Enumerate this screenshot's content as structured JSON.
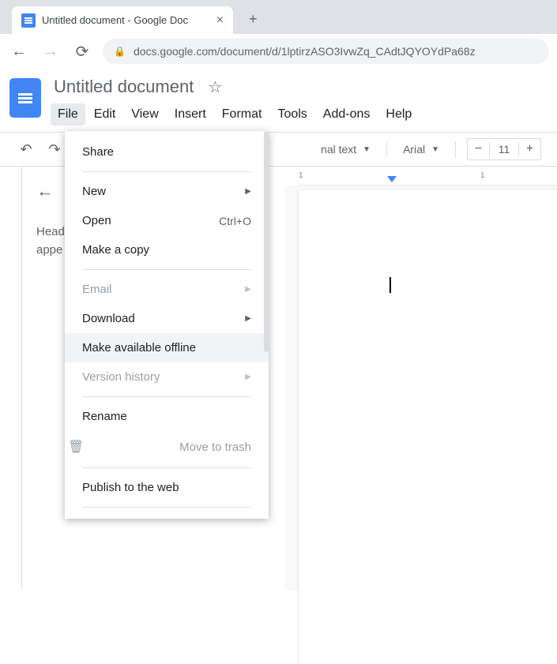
{
  "browser": {
    "tab_title": "Untitled document - Google Doc",
    "url": "docs.google.com/document/d/1lptirzASO3IvwZq_CAdtJQYOYdPa68z"
  },
  "doc": {
    "title": "Untitled document"
  },
  "menubar": {
    "items": [
      "File",
      "Edit",
      "View",
      "Insert",
      "Format",
      "Tools",
      "Add-ons",
      "Help"
    ]
  },
  "toolbar": {
    "style_label": "nal text",
    "font_label": "Arial",
    "font_size": "11"
  },
  "outline": {
    "text_line1": "Head",
    "text_line2": "appe"
  },
  "ruler": {
    "marks": [
      "1",
      "1"
    ]
  },
  "file_menu": {
    "share": "Share",
    "new": "New",
    "open": "Open",
    "open_shortcut": "Ctrl+O",
    "make_copy": "Make a copy",
    "email": "Email",
    "download": "Download",
    "offline": "Make available offline",
    "version_history": "Version history",
    "rename": "Rename",
    "move_trash": "Move to trash",
    "publish": "Publish to the web"
  }
}
